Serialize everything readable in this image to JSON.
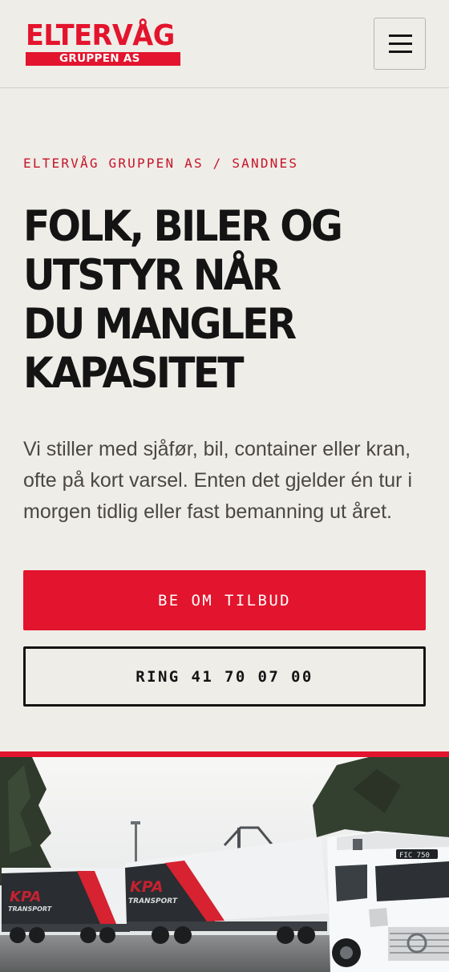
{
  "header": {
    "logo_main": "ELTERVÅG",
    "logo_sub": "GRUPPEN AS",
    "menu_icon": "hamburger-menu-icon"
  },
  "hero": {
    "eyebrow": "ELTERVÅG GRUPPEN AS / SANDNES",
    "headline_lines": [
      "FOLK, BILER OG",
      "UTSTYR NÅR",
      "DU MANGLER",
      "KAPASITET"
    ],
    "lead": "Vi stiller med sjåfør, bil, container eller kran, ofte på kort varsel. Enten det gjelder én tur i morgen tidlig eller fast bemanning ut året."
  },
  "actions": {
    "primary_label": "BE OM TILBUD",
    "secondary_label": "RING 41 70 07 00"
  },
  "photo": {
    "trailer_logo": "KPA",
    "trailer_sub": "TRANSPORT",
    "plate_text": "FIC 750"
  },
  "colors": {
    "brand_red": "#e3142d",
    "background": "#efede8",
    "text": "#141414"
  }
}
